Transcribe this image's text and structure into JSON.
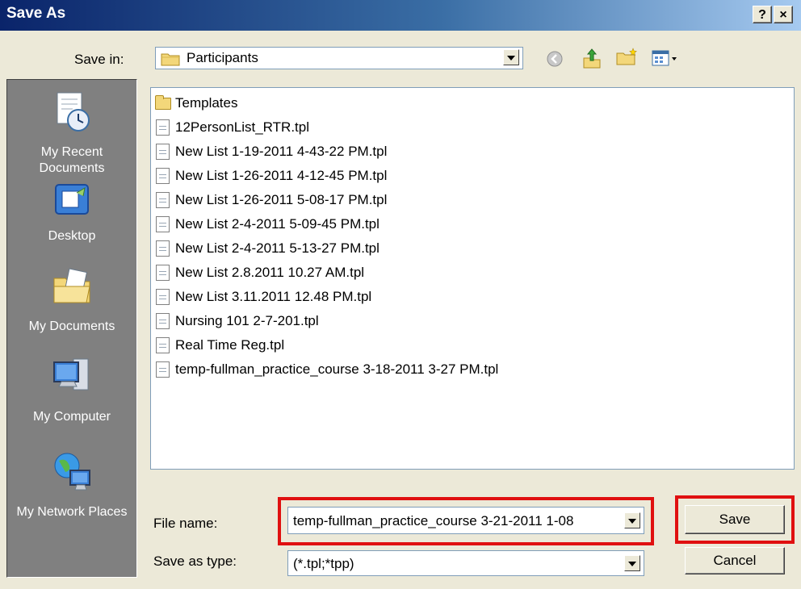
{
  "window": {
    "title": "Save As",
    "help_label": "?",
    "close_label": "×"
  },
  "save_in": {
    "label": "Save in:",
    "value": "Participants"
  },
  "toolbar": {
    "icons": [
      "back-icon",
      "up-folder-icon",
      "new-folder-icon",
      "views-menu-icon"
    ]
  },
  "places": [
    {
      "label": "My Recent Documents",
      "icon": "recent-documents-icon"
    },
    {
      "label": "Desktop",
      "icon": "desktop-icon"
    },
    {
      "label": "My Documents",
      "icon": "my-documents-icon"
    },
    {
      "label": "My Computer",
      "icon": "my-computer-icon"
    },
    {
      "label": "My Network Places",
      "icon": "network-places-icon"
    }
  ],
  "files": [
    {
      "name": "Templates",
      "type": "folder"
    },
    {
      "name": "12PersonList_RTR.tpl",
      "type": "file"
    },
    {
      "name": "New List 1-19-2011 4-43-22 PM.tpl",
      "type": "file"
    },
    {
      "name": "New List 1-26-2011 4-12-45 PM.tpl",
      "type": "file"
    },
    {
      "name": "New List 1-26-2011 5-08-17 PM.tpl",
      "type": "file"
    },
    {
      "name": "New List 2-4-2011 5-09-45 PM.tpl",
      "type": "file"
    },
    {
      "name": "New List 2-4-2011 5-13-27 PM.tpl",
      "type": "file"
    },
    {
      "name": "New List 2.8.2011 10.27 AM.tpl",
      "type": "file"
    },
    {
      "name": "New List 3.11.2011 12.48 PM.tpl",
      "type": "file"
    },
    {
      "name": "Nursing 101 2-7-201.tpl",
      "type": "file"
    },
    {
      "name": "Real Time Reg.tpl",
      "type": "file"
    },
    {
      "name": "temp-fullman_practice_course 3-18-2011 3-27 PM.tpl",
      "type": "file"
    }
  ],
  "file_name": {
    "label": "File name:",
    "value": "temp-fullman_practice_course 3-21-2011 1-08"
  },
  "save_as_type": {
    "label": "Save as type:",
    "value": "(*.tpl;*tpp)"
  },
  "buttons": {
    "save": "Save",
    "cancel": "Cancel"
  },
  "colors": {
    "highlight": "#e01010",
    "places_bg": "#808080",
    "dialog_bg": "#ece9d8"
  }
}
